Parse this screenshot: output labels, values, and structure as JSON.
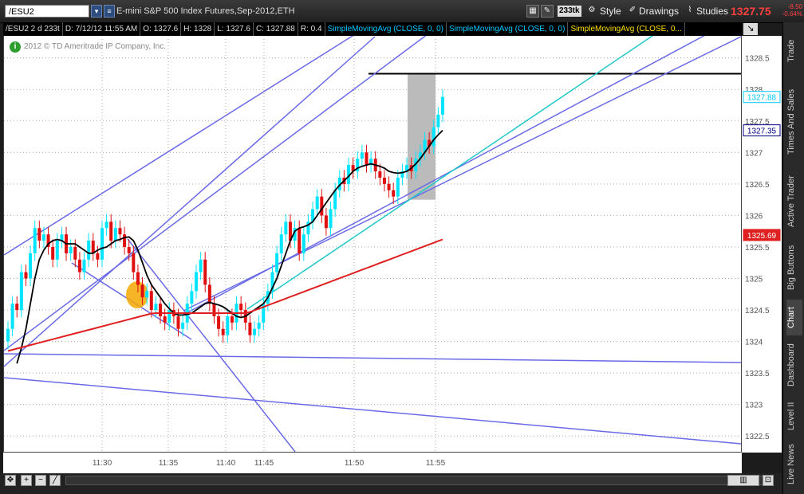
{
  "header": {
    "symbol": "/ESU2",
    "description": "E-mini S&P 500 Index Futures,Sep-2012,ETH",
    "aggregation": "233tk",
    "style_label": "Style",
    "drawings_label": "Drawings",
    "studies_label": "Studies",
    "last_price": "1327.75",
    "net_change": "-8.50",
    "pct_change": "-0.64%"
  },
  "legend": {
    "instrument": "/ESU2 2 d 233t",
    "date": "D: 7/12/12 11:55 AM",
    "open": "O: 1327.6",
    "high": "H: 1328",
    "low": "L: 1327.6",
    "close": "C: 1327.88",
    "range": "R: 0.4",
    "studies": [
      "SimpleMovingAvg (CLOSE, 0, 0)",
      "SimpleMovingAvg (CLOSE, 0, 0)",
      "SimpleMovingAvg (CLOSE, 0..."
    ],
    "study_colors": [
      "#00c8ff",
      "#00c8ff",
      "#ffe000"
    ]
  },
  "copyright": "2012 © TD Ameritrade IP Company, Inc.",
  "sidebar_tabs": [
    "Trade",
    "Times And Sales",
    "Active Trader",
    "Big Buttons",
    "Chart",
    "Dashboard",
    "Level II",
    "Live News"
  ],
  "colors": {
    "up": "#00e5ff",
    "down": "#e01010",
    "sma_fast": "#000000",
    "sma_slow": "#e02020",
    "trend": "#6a6ae8",
    "trend_cyan": "#20c8c8",
    "highlight": "#f5a800"
  },
  "chart_data": {
    "type": "candlestick",
    "xlabel": "",
    "ylabel": "",
    "ylim": [
      1322.25,
      1328.85
    ],
    "y_ticks": [
      "1322.5",
      "1323",
      "1323.5",
      "1324",
      "1324.5",
      "1325",
      "1325.5",
      "1326",
      "1326.5",
      "1327",
      "1327.5",
      "1328",
      "1328.5"
    ],
    "x_ticks": [
      "11:30",
      "11:35",
      "11:40",
      "11:45",
      "11:50",
      "11:55"
    ],
    "price_tags": [
      {
        "label": "1327.88",
        "value": 1327.88,
        "color": "#00c8ff"
      },
      {
        "label": "1327.35",
        "value": 1327.35,
        "color": "#000080"
      },
      {
        "label": "1325.69",
        "value": 1325.69,
        "color": "#e02020"
      }
    ],
    "horizontal_line": 1328.25,
    "closes": [
      1324.2,
      1324.6,
      1324.5,
      1325.1,
      1325.0,
      1325.4,
      1325.8,
      1325.6,
      1325.7,
      1325.5,
      1325.3,
      1325.6,
      1325.7,
      1325.4,
      1325.5,
      1325.3,
      1325.1,
      1325.3,
      1325.6,
      1325.4,
      1325.3,
      1325.8,
      1325.9,
      1325.6,
      1325.8,
      1325.7,
      1325.5,
      1325.4,
      1325.1,
      1324.9,
      1324.7,
      1324.8,
      1324.5,
      1324.6,
      1324.4,
      1324.3,
      1324.5,
      1324.4,
      1324.2,
      1324.3,
      1324.6,
      1324.8,
      1325.1,
      1325.3,
      1324.9,
      1324.6,
      1324.4,
      1324.2,
      1324.1,
      1324.4,
      1324.3,
      1324.6,
      1324.5,
      1324.3,
      1324.1,
      1324.2,
      1324.3,
      1324.6,
      1324.8,
      1325.1,
      1325.4,
      1325.7,
      1325.9,
      1325.6,
      1325.8,
      1325.4,
      1325.7,
      1325.9,
      1326.1,
      1326.3,
      1326.0,
      1325.8,
      1326.1,
      1326.4,
      1326.6,
      1326.5,
      1326.8,
      1326.7,
      1326.9,
      1327.0,
      1326.8,
      1326.9,
      1326.7,
      1326.6,
      1326.5,
      1326.4,
      1326.3,
      1326.6,
      1326.7,
      1326.8,
      1326.7,
      1326.9,
      1327.0,
      1327.2,
      1327.1,
      1327.4,
      1327.6,
      1327.88
    ],
    "sma_fast": [
      1323.65,
      1323.9,
      1324.2,
      1324.6,
      1325.0,
      1325.3,
      1325.45,
      1325.55,
      1325.6,
      1325.62,
      1325.6,
      1325.55,
      1325.55,
      1325.55,
      1325.5,
      1325.45,
      1325.4,
      1325.4,
      1325.45,
      1325.48,
      1325.5,
      1325.55,
      1325.6,
      1325.62,
      1325.65,
      1325.66,
      1325.6,
      1325.45,
      1325.25,
      1325.05,
      1324.9,
      1324.8,
      1324.7,
      1324.6,
      1324.52,
      1324.45,
      1324.42,
      1324.42,
      1324.43,
      1324.45,
      1324.5,
      1324.55,
      1324.6,
      1324.62,
      1324.6,
      1324.58,
      1324.55,
      1324.5,
      1324.45,
      1324.4,
      1324.38,
      1324.4,
      1324.45,
      1324.5,
      1324.55,
      1324.6,
      1324.7,
      1324.85,
      1325.0,
      1325.2,
      1325.4,
      1325.6,
      1325.75,
      1325.8,
      1325.82,
      1325.85,
      1325.9,
      1326.0,
      1326.1,
      1326.2,
      1326.3,
      1326.4,
      1326.48,
      1326.55,
      1326.62,
      1326.7,
      1326.75,
      1326.78,
      1326.8,
      1326.82,
      1326.8,
      1326.78,
      1326.75,
      1326.7,
      1326.68,
      1326.67,
      1326.68,
      1326.7,
      1326.75,
      1326.82,
      1326.9,
      1327.0,
      1327.1,
      1327.2,
      1327.28,
      1327.35
    ]
  }
}
